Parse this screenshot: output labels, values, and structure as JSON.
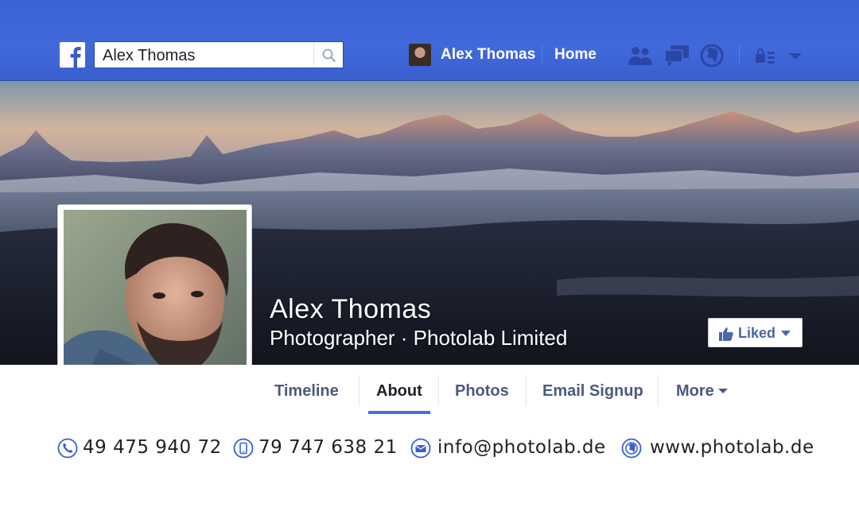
{
  "header": {
    "logo_icon": "facebook-f-icon",
    "search": {
      "value": "Alex Thomas",
      "icon": "search-icon"
    },
    "user_name": "Alex Thomas",
    "home_label": "Home",
    "icons": [
      "friend-requests-icon",
      "messages-icon",
      "notifications-globe-icon",
      "privacy-shortcuts-icon",
      "account-menu-caret-icon"
    ],
    "bar_color": "#3b63d6"
  },
  "profile": {
    "name": "Alex Thomas",
    "subtitle": "Photographer · Photolab Limited",
    "liked_label": "Liked"
  },
  "tabs": [
    {
      "label": "Timeline",
      "active": false
    },
    {
      "label": "About",
      "active": true
    },
    {
      "label": "Photos",
      "active": false
    },
    {
      "label": "Email Signup",
      "active": false
    },
    {
      "label": "More",
      "active": false
    }
  ],
  "contacts": [
    {
      "icon": "phone-icon",
      "text": "49 475 940 72"
    },
    {
      "icon": "mobile-phone-icon",
      "text": "79 747 638 21"
    },
    {
      "icon": "email-icon",
      "text": "info@photolab.de"
    },
    {
      "icon": "globe-icon",
      "text": "www.photolab.de"
    }
  ],
  "colors": {
    "accent": "#4a6fd6",
    "icon_blue": "#3b5fd0"
  }
}
